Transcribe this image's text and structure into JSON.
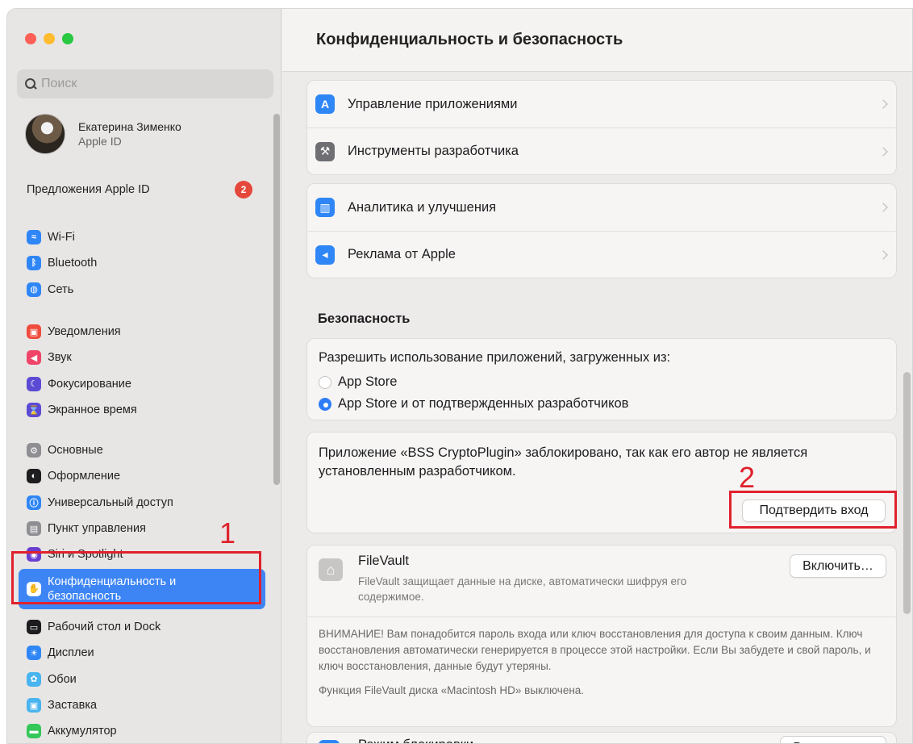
{
  "window": {
    "traffic": [
      "close",
      "minimize",
      "zoom"
    ]
  },
  "sidebar": {
    "search_placeholder": "Поиск",
    "user": {
      "name": "Екатерина Зименко",
      "sub": "Apple ID"
    },
    "offers": {
      "label": "Предложения Apple ID",
      "badge": "2"
    },
    "groups": [
      [
        {
          "label": "Wi-Fi",
          "icon": "wifi-icon",
          "color": "#2f86f6",
          "glyph": "≈"
        },
        {
          "label": "Bluetooth",
          "icon": "bluetooth-icon",
          "color": "#2f86f6",
          "glyph": "ᛒ"
        },
        {
          "label": "Сеть",
          "icon": "globe-icon",
          "color": "#2f86f6",
          "glyph": "◍"
        }
      ],
      [
        {
          "label": "Уведомления",
          "icon": "notifications-icon",
          "color": "#ef4c3d",
          "glyph": "▣"
        },
        {
          "label": "Звук",
          "icon": "sound-icon",
          "color": "#ef4468",
          "glyph": "◀"
        },
        {
          "label": "Фокусирование",
          "icon": "focus-moon-icon",
          "color": "#5b4bd4",
          "glyph": "☾"
        },
        {
          "label": "Экранное время",
          "icon": "hourglass-icon",
          "color": "#5b4bd4",
          "glyph": "⌛"
        }
      ],
      [
        {
          "label": "Основные",
          "icon": "gear-icon",
          "color": "#8e8e93",
          "glyph": "⚙"
        },
        {
          "label": "Оформление",
          "icon": "appearance-icon",
          "color": "#1d1d1f",
          "glyph": "◐"
        },
        {
          "label": "Универсальный доступ",
          "icon": "accessibility-icon",
          "color": "#2f86f6",
          "glyph": "ⓘ"
        },
        {
          "label": "Пункт управления",
          "icon": "control-center-icon",
          "color": "#8e8e93",
          "glyph": "▤"
        },
        {
          "label": "Siri и Spotlight",
          "icon": "siri-icon",
          "color": "#6a3fd0",
          "glyph": "◉"
        },
        {
          "label": "Конфиденциальность и безопасность",
          "icon": "privacy-hand-icon",
          "color": "#2f86f6",
          "glyph": "✋",
          "active": true
        }
      ],
      [
        {
          "label": "Рабочий стол и Dock",
          "icon": "dock-icon",
          "color": "#1d1d1f",
          "glyph": "▭"
        },
        {
          "label": "Дисплеи",
          "icon": "display-sun-icon",
          "color": "#2f86f6",
          "glyph": "☀"
        },
        {
          "label": "Обои",
          "icon": "wallpaper-icon",
          "color": "#49b4ef",
          "glyph": "✿"
        },
        {
          "label": "Заставка",
          "icon": "screensaver-icon",
          "color": "#49b4ef",
          "glyph": "▣"
        },
        {
          "label": "Аккумулятор",
          "icon": "battery-icon",
          "color": "#34c759",
          "glyph": "▬"
        }
      ]
    ]
  },
  "main": {
    "title": "Конфиденциальность и безопасность",
    "group1": [
      {
        "label": "Управление приложениями",
        "icon": "app-store-icon",
        "color": "#2f86f6",
        "glyph": "A"
      },
      {
        "label": "Инструменты разработчика",
        "icon": "hammer-icon",
        "color": "#6e6e73",
        "glyph": "⚒"
      }
    ],
    "group2": [
      {
        "label": "Аналитика и улучшения",
        "icon": "analytics-icon",
        "color": "#2f86f6",
        "glyph": "▥"
      },
      {
        "label": "Реклама от Apple",
        "icon": "megaphone-icon",
        "color": "#2f86f6",
        "glyph": "◂"
      }
    ],
    "security": {
      "title": "Безопасность",
      "allow_label": "Разрешить использование приложений, загруженных из:",
      "options": [
        "App Store",
        "App Store и от подтвержденных разработчиков"
      ],
      "selected": 1,
      "blocked_text": "Приложение «BSS CryptoPlugin» заблокировано, так как его автор не является установленным разработчиком.",
      "confirm_button": "Подтвердить вход"
    },
    "filevault": {
      "title": "FileVault",
      "desc": "FileVault защищает данные на диске, автоматически шифруя его содержимое.",
      "button": "Включить…",
      "warning": "ВНИМАНИЕ! Вам понадобится пароль входа или ключ восстановления для доступа к своим данным. Ключ восстановления автоматически генерируется в процессе этой настройки. Если Вы забудете и свой пароль, и ключ восстановления, данные будут утеряны.",
      "status": "Функция FileVault диска «Macintosh HD» выключена."
    },
    "lockdown": {
      "title": "Режим блокировки",
      "button": "Выключить…"
    }
  },
  "annotations": {
    "first": "1",
    "second": "2",
    "color": "#e0212d"
  }
}
